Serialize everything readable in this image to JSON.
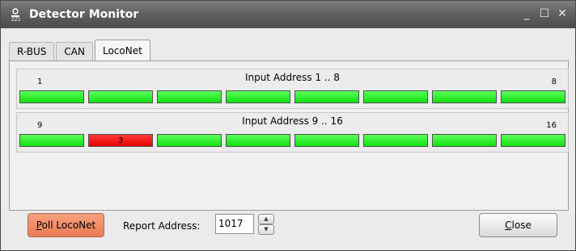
{
  "window": {
    "title": "Detector Monitor",
    "controls": {
      "minimize": "_",
      "maximize": "☐",
      "close": "✕"
    }
  },
  "tabs": [
    {
      "label": "R-BUS",
      "active": false
    },
    {
      "label": "CAN",
      "active": false
    },
    {
      "label": "LocoNet",
      "active": true
    }
  ],
  "rows": [
    {
      "title": "Input Address 1 .. 8",
      "first": "1",
      "last": "8",
      "detectors": [
        {
          "label": "",
          "state": "free"
        },
        {
          "label": "",
          "state": "free"
        },
        {
          "label": "",
          "state": "free"
        },
        {
          "label": "",
          "state": "free"
        },
        {
          "label": "",
          "state": "free"
        },
        {
          "label": "",
          "state": "free"
        },
        {
          "label": "",
          "state": "free"
        },
        {
          "label": "",
          "state": "free"
        }
      ]
    },
    {
      "title": "Input Address 9 .. 16",
      "first": "9",
      "last": "16",
      "detectors": [
        {
          "label": "",
          "state": "free"
        },
        {
          "label": "3",
          "state": "occupied"
        },
        {
          "label": "",
          "state": "free"
        },
        {
          "label": "",
          "state": "free"
        },
        {
          "label": "",
          "state": "free"
        },
        {
          "label": "",
          "state": "free"
        },
        {
          "label": "",
          "state": "free"
        },
        {
          "label": "",
          "state": "free"
        }
      ]
    }
  ],
  "footer": {
    "poll_label": "Poll LocoNet",
    "report_label": "Report Address:",
    "report_value": "1017",
    "close_label": "Close"
  },
  "colors": {
    "free": "#22ee22",
    "occupied": "#ff1a1a",
    "poll_button": "#f08a62"
  }
}
